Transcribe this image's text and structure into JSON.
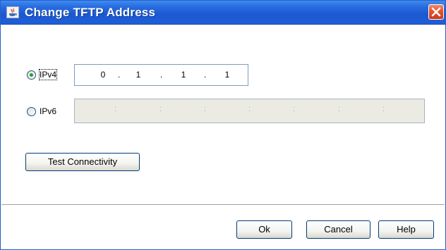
{
  "window": {
    "title": "Change TFTP Address",
    "accent": "#2a6de0"
  },
  "ipv4": {
    "label": "IPv4",
    "selected": true,
    "octets": [
      "0",
      "1",
      "1",
      "1"
    ],
    "separator": "."
  },
  "ipv6": {
    "label": "IPv6",
    "selected": false,
    "separator": ":"
  },
  "buttons": {
    "test_connectivity": "Test Connectivity",
    "ok": "Ok",
    "cancel": "Cancel",
    "help": "Help"
  }
}
